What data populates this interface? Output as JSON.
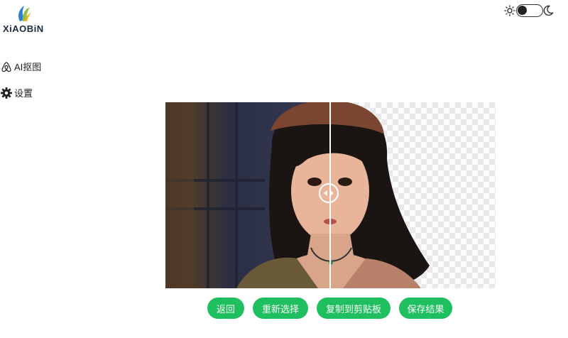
{
  "logo": {
    "text": "XiAOBiN"
  },
  "sidebar": {
    "items": [
      {
        "label": "AI抠图",
        "icon": "airbnb-icon"
      },
      {
        "label": "设置",
        "icon": "gear-icon"
      }
    ]
  },
  "theme_toggle": {
    "mode": "dark",
    "left_icon": "sun-icon",
    "right_icon": "moon-icon"
  },
  "viewer": {
    "original_image": "character-portrait-image",
    "result_image": "transparent-cutout-image",
    "divider_position": 0.5
  },
  "actions": {
    "back": "返回",
    "reselect": "重新选择",
    "copy": "复制到剪贴板",
    "save": "保存结果"
  },
  "colors": {
    "accent": "#1fbf5f",
    "logo_text": "#1d2a3c"
  }
}
